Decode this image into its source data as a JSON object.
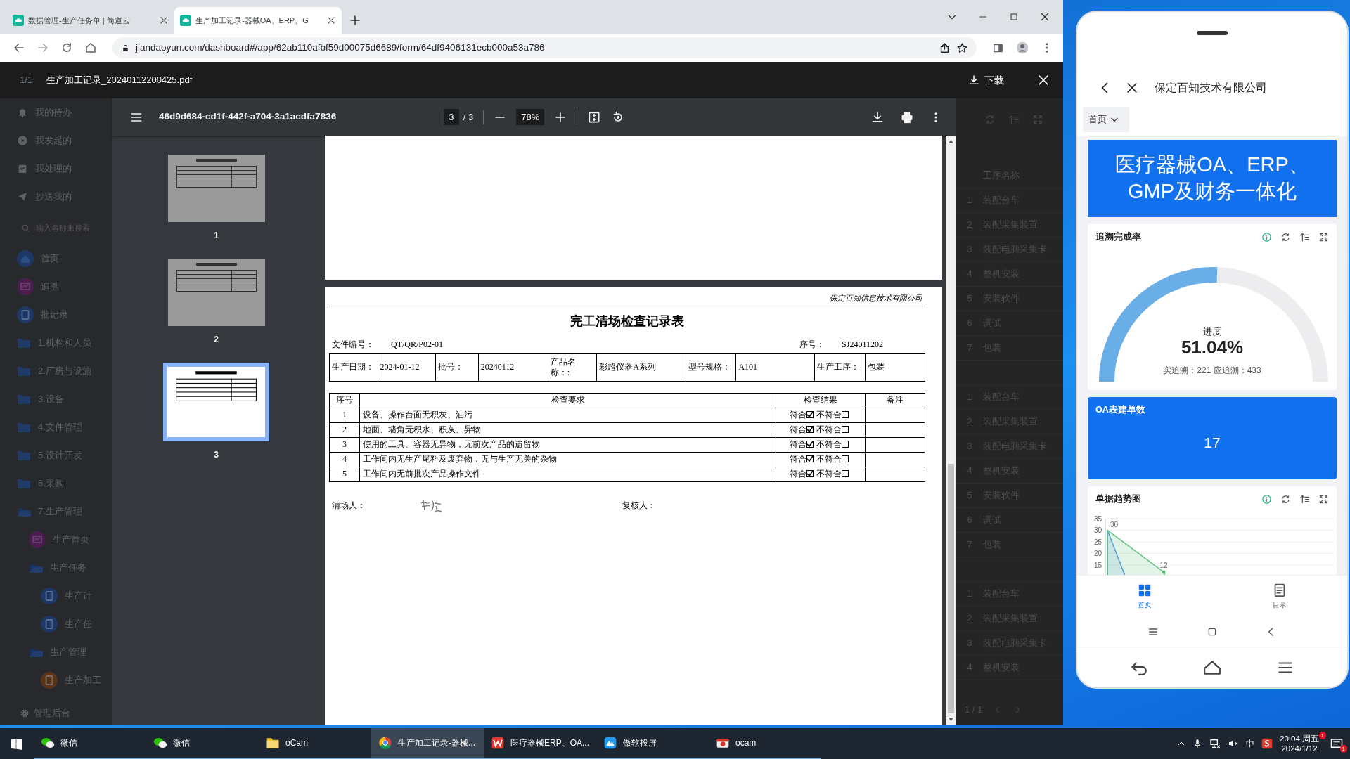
{
  "browser": {
    "tabs": [
      {
        "title": "数据管理-生产任务单 | 简道云",
        "selected": false
      },
      {
        "title": "生产加工记录-器械OA、ERP、G",
        "selected": true
      }
    ],
    "url": "jiandaoyun.com/dashboard#/app/62ab110afbf59d00075d6689/form/64df9406131ecb000a53a786"
  },
  "viewer": {
    "page_counter": "1/1",
    "filename": "生产加工记录_20240112200425.pdf",
    "download_label": "下载"
  },
  "app_sidebar": {
    "shortcuts": [
      {
        "label": "我的待办",
        "kind": "bell"
      },
      {
        "label": "我发起的",
        "kind": "play"
      },
      {
        "label": "我处理的",
        "kind": "inbox"
      },
      {
        "label": "抄送我的",
        "kind": "send"
      }
    ],
    "search": {
      "placeholder": "输入名称来搜索"
    },
    "nav": [
      {
        "label": "首页",
        "kind": "home",
        "color": "#1d3766"
      },
      {
        "label": "追溯",
        "kind": "chart",
        "color": "#4a1f4f"
      },
      {
        "label": "批记录",
        "kind": "form",
        "color": "#1d3766"
      },
      {
        "label": "1.机构和人员",
        "kind": "folder",
        "expanded": false
      },
      {
        "label": "2.厂房与设施",
        "kind": "folder",
        "expanded": false
      },
      {
        "label": "3.设备",
        "kind": "folder",
        "expanded": false
      },
      {
        "label": "4.文件管理",
        "kind": "folder",
        "expanded": false
      },
      {
        "label": "5.设计开发",
        "kind": "folder",
        "expanded": false
      },
      {
        "label": "6.采购",
        "kind": "folder",
        "expanded": false
      },
      {
        "label": "7.生产管理",
        "kind": "folder",
        "expanded": true,
        "children": [
          {
            "label": "生产首页",
            "kind": "chart",
            "color": "#4a1f4f"
          },
          {
            "label": "生产任务",
            "kind": "folder",
            "expanded": true,
            "children": [
              {
                "label": "生产计",
                "kind": "form",
                "color": "#1d3766"
              },
              {
                "label": "生产任",
                "kind": "form",
                "color": "#1d3766"
              }
            ]
          },
          {
            "label": "生产管理",
            "kind": "folder",
            "expanded": true,
            "children": [
              {
                "label": "生产加工",
                "kind": "form",
                "color": "#5b3416"
              }
            ]
          }
        ]
      }
    ],
    "footer": "管理后台"
  },
  "pdf": {
    "doc_id": "46d9d684-cd1f-442f-a704-3a1acdfa7836",
    "page": "3",
    "page_total": "/ 3",
    "zoom": "78%",
    "thumbnails": [
      {
        "label": "1",
        "selected": false
      },
      {
        "label": "2",
        "selected": false
      },
      {
        "label": "3",
        "selected": true
      }
    ]
  },
  "document": {
    "company": "保定百知信息技术有限公司",
    "title": "完工清场检查记录表",
    "file_no_label": "文件编号：",
    "file_no": "QT/QR/P02-01",
    "serial_label": "序号：",
    "serial": "SJ24011202",
    "info": [
      {
        "label": "生产日期：",
        "value": "2024-01-12"
      },
      {
        "label": "批号：",
        "value": "20240112"
      },
      {
        "label": "产品名称：:",
        "value": "彩超仪器A系列"
      },
      {
        "label": "型号规格：",
        "value": "A101"
      },
      {
        "label": "生产工序：",
        "value": "包装"
      }
    ],
    "columns": [
      "序号",
      "检查要求",
      "检查结果",
      "备注"
    ],
    "rows": [
      {
        "no": "1",
        "requirement": "设备、操作台面无积灰、油污",
        "pass_label": "符合",
        "pass": true,
        "fail_label": "不符合",
        "fail": false
      },
      {
        "no": "2",
        "requirement": "地面、墙角无积水、积灰、异物",
        "pass_label": "符合",
        "pass": true,
        "fail_label": "不符合",
        "fail": false
      },
      {
        "no": "3",
        "requirement": "使用的工具、容器无异物，无前次产品的遗留物",
        "pass_label": "符合",
        "pass": true,
        "fail_label": "不符合",
        "fail": false
      },
      {
        "no": "4",
        "requirement": "工作间内无生产尾料及废弃物，无与生产无关的杂物",
        "pass_label": "符合",
        "pass": true,
        "fail_label": "不符合",
        "fail": false
      },
      {
        "no": "5",
        "requirement": "工作间内无前批次产品操作文件",
        "pass_label": "符合",
        "pass": true,
        "fail_label": "不符合",
        "fail": false
      }
    ],
    "cleaner_label": "清场人：",
    "reviewer_label": "复核人："
  },
  "process_list": {
    "column": "工序名称",
    "groups": [
      {
        "rows": [
          {
            "no": "1",
            "name": "装配台车"
          },
          {
            "no": "2",
            "name": "装配采集装置"
          },
          {
            "no": "3",
            "name": "装配电脑采集卡"
          },
          {
            "no": "4",
            "name": "整机安装"
          },
          {
            "no": "5",
            "name": "安装软件"
          },
          {
            "no": "6",
            "name": "调试"
          },
          {
            "no": "7",
            "name": "包装"
          }
        ]
      },
      {
        "rows": [
          {
            "no": "1",
            "name": "装配台车"
          },
          {
            "no": "2",
            "name": "装配采集装置"
          },
          {
            "no": "3",
            "name": "装配电脑采集卡"
          },
          {
            "no": "4",
            "name": "整机安装"
          },
          {
            "no": "5",
            "name": "安装软件"
          },
          {
            "no": "6",
            "name": "调试"
          },
          {
            "no": "7",
            "name": "包装"
          }
        ]
      },
      {
        "rows": [
          {
            "no": "1",
            "name": "装配台车"
          },
          {
            "no": "2",
            "name": "装配采集装置"
          },
          {
            "no": "3",
            "name": "装配电脑采集卡"
          },
          {
            "no": "4",
            "name": "整机安装"
          }
        ]
      }
    ],
    "pager": "1 / 1"
  },
  "phone": {
    "title": "保定百知技术有限公司",
    "page_select": "首页",
    "banner": [
      "医疗器械OA、ERP、",
      "GMP及财务一体化"
    ],
    "gauge_card": {
      "title": "追溯完成率",
      "caption": "进度",
      "value": "51.04%",
      "level": 0.5104,
      "detail": "实追溯：221 应追溯：433"
    },
    "count_card": {
      "title": "OA表建单数",
      "value": "17"
    },
    "trend_card": {
      "title": "单据趋势图",
      "axis_labels": [
        "35",
        "30",
        "25",
        "20",
        "15"
      ],
      "point_labels": [
        "30",
        "12"
      ]
    },
    "tabs": [
      {
        "label": "首页",
        "selected": true
      },
      {
        "label": "目录",
        "selected": false
      }
    ]
  },
  "taskbar": {
    "apps": [
      {
        "label": "微信",
        "kind": "chat",
        "selected": false
      },
      {
        "label": "微信",
        "kind": "chat",
        "selected": false
      },
      {
        "label": "oCam",
        "kind": "folder",
        "selected": false
      },
      {
        "label": "生产加工记录-器械...",
        "kind": "browser",
        "selected": true
      },
      {
        "label": "医疗器械ERP、OA...",
        "kind": "office",
        "selected": false
      },
      {
        "label": "傲软投屏",
        "kind": "cast",
        "selected": false
      },
      {
        "label": "ocam",
        "kind": "camera",
        "selected": false
      }
    ],
    "ime": "中",
    "time": "20:04 周五",
    "time_badge": "1",
    "date": "2024/1/12",
    "notification_badge": "1"
  }
}
